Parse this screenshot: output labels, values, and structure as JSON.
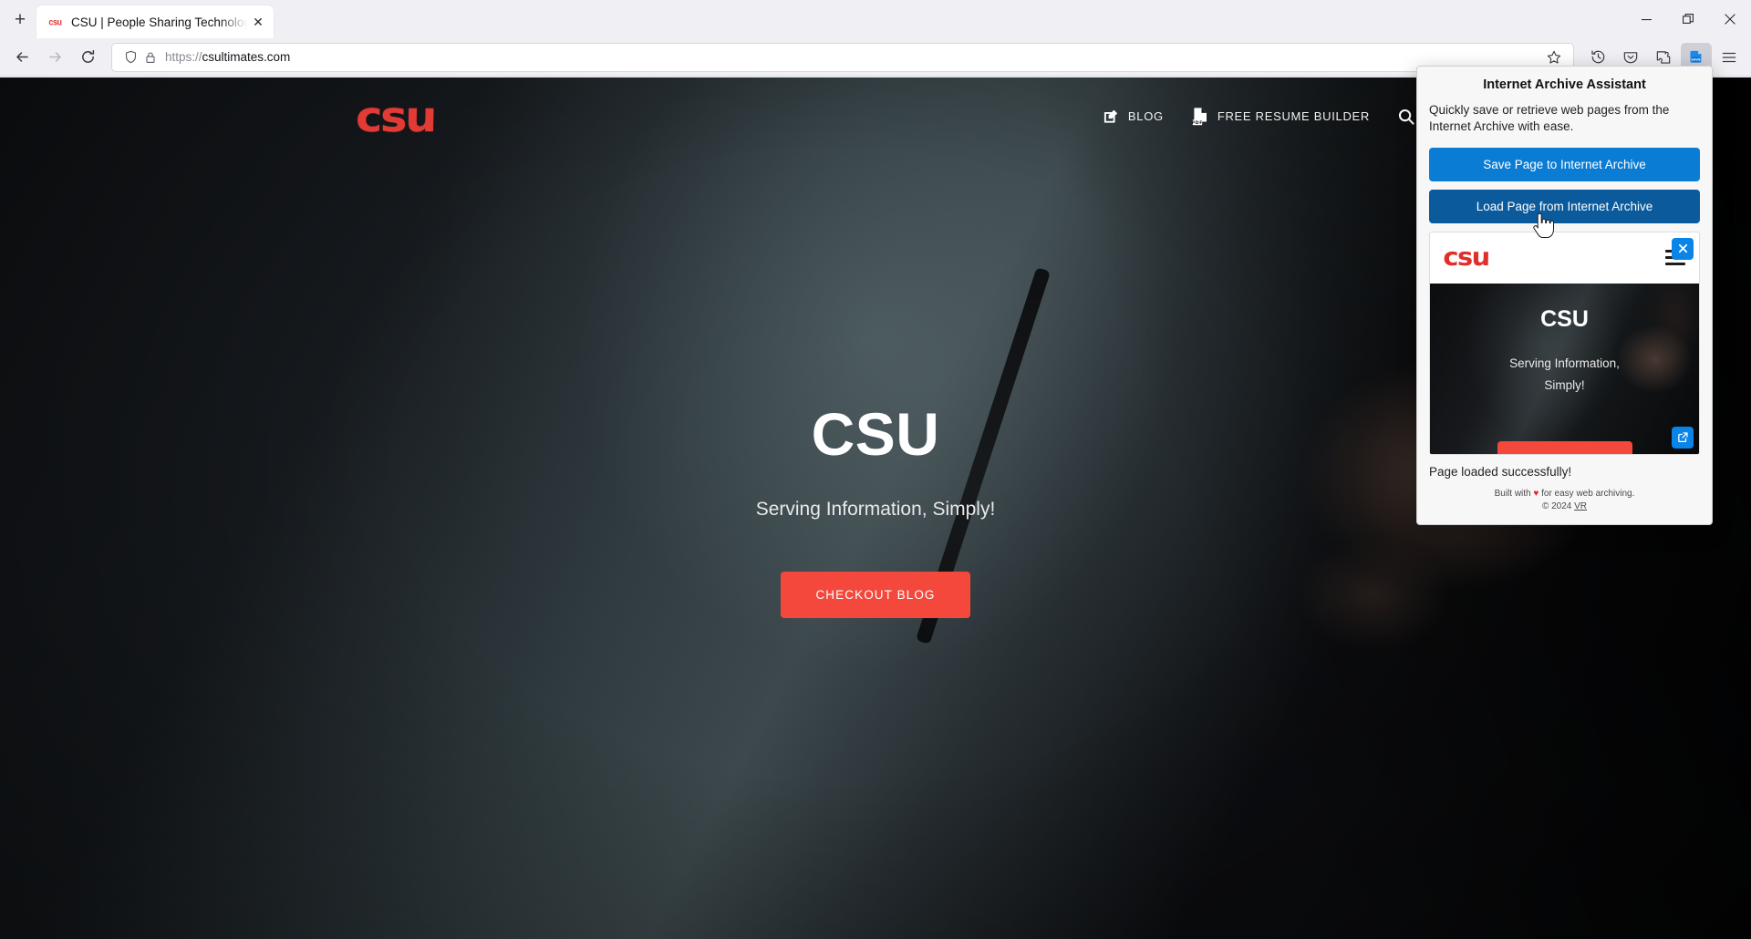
{
  "browser": {
    "new_tab_label": "+",
    "tab": {
      "favicon_text": "csu",
      "title": "CSU | People Sharing Technolog",
      "close_label": "✕"
    },
    "window_controls": {
      "minimize": "minimize-button",
      "restore": "restore-button",
      "close": "close-button"
    },
    "nav": {
      "back": "back-button",
      "forward": "forward-button",
      "reload": "reload-button"
    },
    "url": {
      "scheme": "https://",
      "host": "csultimates.com",
      "shield_icon": "shield-icon",
      "lock_icon": "lock-icon",
      "bookmark_icon": "star-icon",
      "history_icon": "history-icon"
    },
    "toolbar": {
      "pocket": "pocket-icon",
      "extensions": "extensions-puzzle-icon",
      "archive_extension": "archive-save-extension-icon",
      "archive_extension_label": "SAVE",
      "app_menu": "hamburger-menu-icon"
    }
  },
  "page": {
    "logo": "csu",
    "nav": [
      {
        "label": "BLOG",
        "icon": "pencil-edit-icon"
      },
      {
        "label": "FREE RESUME BUILDER",
        "icon": "pdf-file-icon"
      }
    ],
    "search_icon": "search-icon",
    "hero": {
      "title": "CSU",
      "subtitle": "Serving Information, Simply!",
      "cta_label": "CHECKOUT BLOG",
      "cta_color": "#f4483c"
    }
  },
  "popup": {
    "title": "Internet Archive Assistant",
    "description": "Quickly save or retrieve web pages from the Internet Archive with ease.",
    "save_button": "Save Page to Internet Archive",
    "load_button": "Load Page from Internet Archive",
    "save_button_color": "#0a7cd4",
    "load_button_color": "#0b5b9c",
    "preview": {
      "logo": "csu",
      "menu_icon": "hamburger-menu-icon",
      "close_icon": "close-icon",
      "open_external_icon": "external-link-icon",
      "hero_title": "CSU",
      "hero_subtitle_line1": "Serving Information,",
      "hero_subtitle_line2": "Simply!"
    },
    "status": "Page loaded successfully!",
    "footer_line1_pre": "Built with ",
    "footer_heart": "♥",
    "footer_line1_post": " for easy web archiving.",
    "footer_line2_pre": "© 2024 ",
    "footer_link": "VR"
  }
}
